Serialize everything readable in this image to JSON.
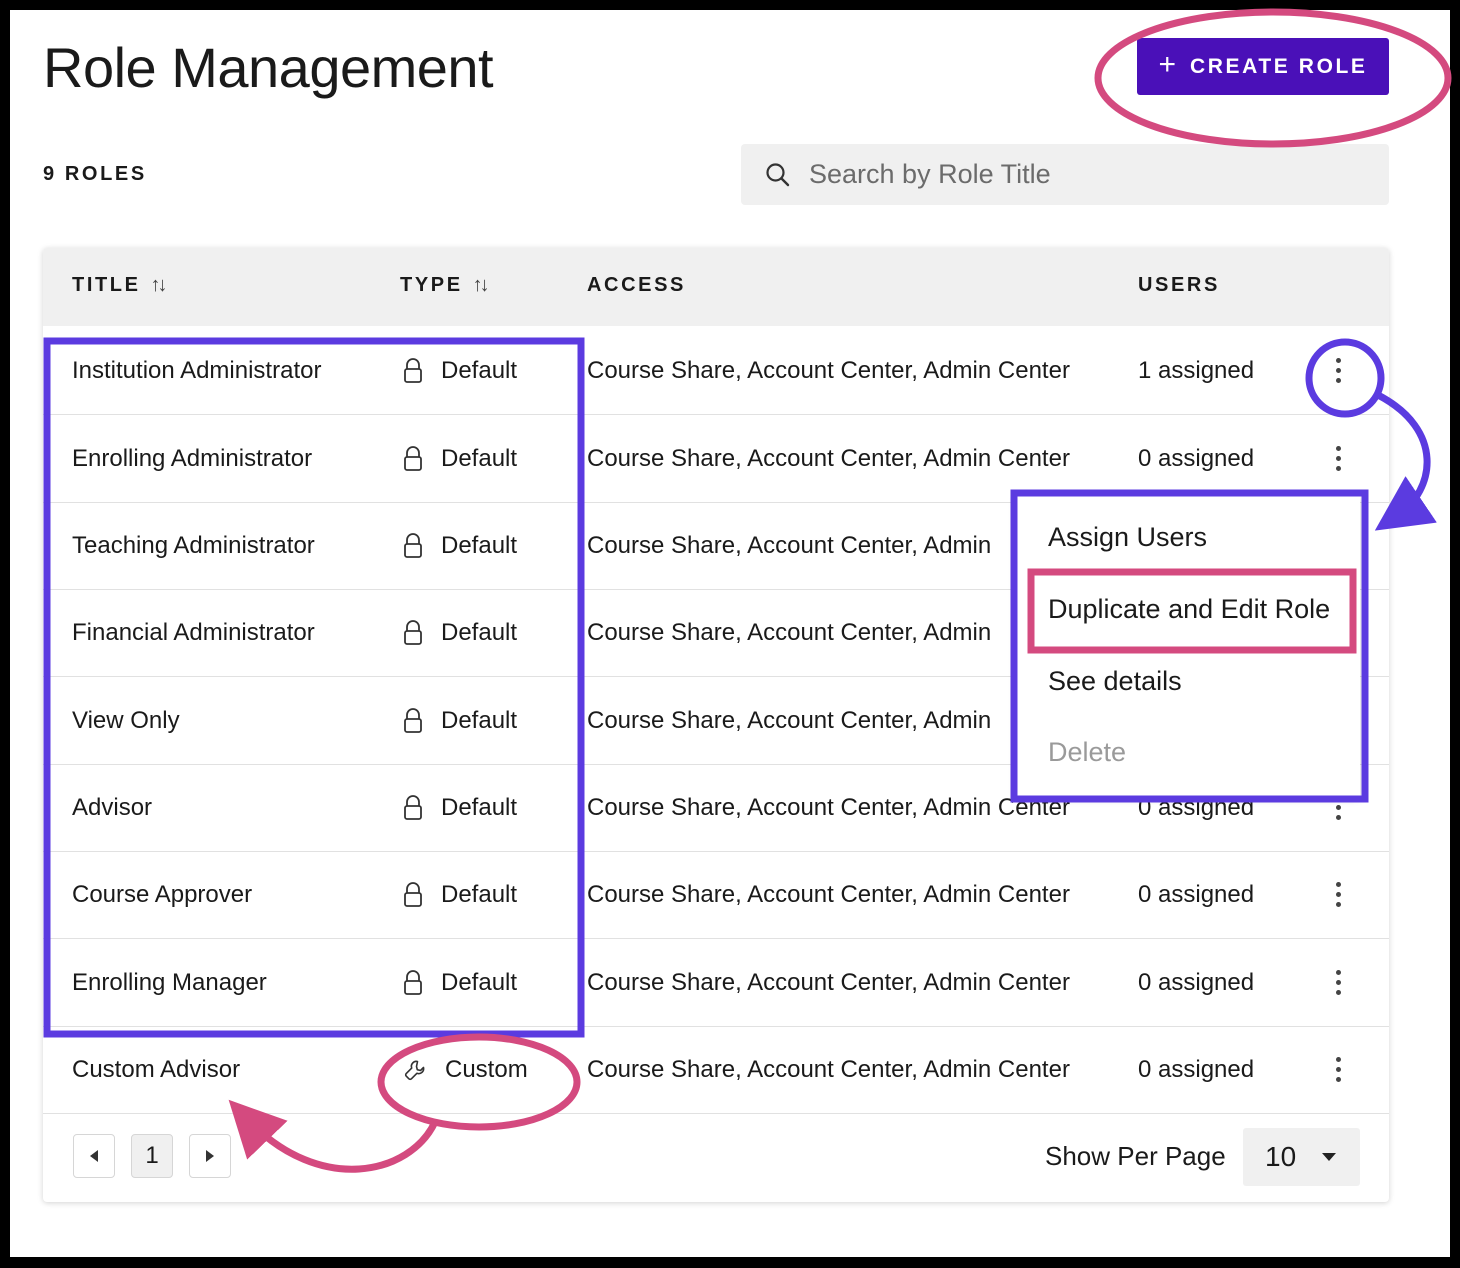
{
  "header": {
    "title": "Role Management",
    "create_button": {
      "icon": "plus-icon",
      "label": "CREATE ROLE"
    }
  },
  "roles_count": "9 ROLES",
  "search": {
    "placeholder": "Search by Role Title",
    "value": "",
    "icon": "search-icon"
  },
  "table": {
    "columns": [
      "TITLE",
      "TYPE",
      "ACCESS",
      "USERS"
    ],
    "rows": [
      {
        "title": "Institution Administrator",
        "type": "Default",
        "type_icon": "lock-icon",
        "access": "Course Share, Account Center, Admin Center",
        "users": "1 assigned"
      },
      {
        "title": "Enrolling Administrator",
        "type": "Default",
        "type_icon": "lock-icon",
        "access": "Course Share, Account Center, Admin Center",
        "users": "0 assigned"
      },
      {
        "title": "Teaching Administrator",
        "type": "Default",
        "type_icon": "lock-icon",
        "access": "Course Share, Account Center, Admin",
        "users": ""
      },
      {
        "title": "Financial Administrator",
        "type": "Default",
        "type_icon": "lock-icon",
        "access": "Course Share, Account Center, Admin",
        "users": ""
      },
      {
        "title": "View Only",
        "type": "Default",
        "type_icon": "lock-icon",
        "access": "Course Share, Account Center, Admin",
        "users": ""
      },
      {
        "title": "Advisor",
        "type": "Default",
        "type_icon": "lock-icon",
        "access": "Course Share, Account Center, Admin Center",
        "users": "0 assigned"
      },
      {
        "title": "Course Approver",
        "type": "Default",
        "type_icon": "lock-icon",
        "access": "Course Share, Account Center, Admin Center",
        "users": "0 assigned"
      },
      {
        "title": "Enrolling Manager",
        "type": "Default",
        "type_icon": "lock-icon",
        "access": "Course Share, Account Center, Admin Center",
        "users": "0 assigned"
      },
      {
        "title": "Custom Advisor",
        "type": "Custom",
        "type_icon": "wrench-icon",
        "access": "Course Share, Account Center, Admin Center",
        "users": "0 assigned"
      }
    ]
  },
  "row_menu": {
    "items": [
      {
        "label": "Assign Users",
        "disabled": false
      },
      {
        "label": "Duplicate and Edit Role",
        "disabled": false
      },
      {
        "label": "See details",
        "disabled": false
      },
      {
        "label": "Delete",
        "disabled": true
      }
    ]
  },
  "pagination": {
    "current_page": "1",
    "show_per_page_label": "Show Per Page",
    "per_page_value": "10"
  },
  "colors": {
    "primary": "#4A10B8",
    "annotation_purple": "#5B3BE0",
    "annotation_pink": "#D44A7F",
    "header_bg": "#F0F0F0"
  }
}
